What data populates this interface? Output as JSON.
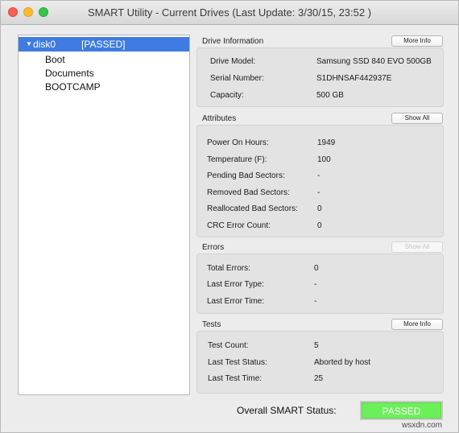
{
  "window": {
    "title": "SMART Utility - Current Drives (Last Update: 3/30/15, 23:52 )"
  },
  "sidebar": {
    "disk": {
      "name": "disk0",
      "status": "[PASSED]"
    },
    "volumes": [
      "Boot",
      "Documents",
      "BOOTCAMP"
    ]
  },
  "drive_information": {
    "title": "Drive Information",
    "button": "More Info",
    "rows": [
      {
        "label": "Drive Model:",
        "value": "Samsung SSD 840 EVO 500GB"
      },
      {
        "label": "Serial Number:",
        "value": "S1DHNSAF442937E"
      },
      {
        "label": "Capacity:",
        "value": "500 GB"
      }
    ]
  },
  "attributes": {
    "title": "Attributes",
    "button": "Show All",
    "rows": [
      {
        "label": "Power On Hours:",
        "value": "1949"
      },
      {
        "label": "Temperature (F):",
        "value": "100"
      },
      {
        "label": "Pending Bad Sectors:",
        "value": "-"
      },
      {
        "label": "Removed Bad Sectors:",
        "value": "-"
      },
      {
        "label": "Reallocated Bad Sectors:",
        "value": "0"
      },
      {
        "label": "CRC Error Count:",
        "value": "0"
      }
    ]
  },
  "errors": {
    "title": "Errors",
    "button": "Show All",
    "rows": [
      {
        "label": "Total Errors:",
        "value": "0"
      },
      {
        "label": "Last Error Type:",
        "value": "-"
      },
      {
        "label": "Last Error Time:",
        "value": "-"
      }
    ]
  },
  "tests": {
    "title": "Tests",
    "button": "More Info",
    "rows": [
      {
        "label": "Test Count:",
        "value": "5"
      },
      {
        "label": "Last Test Status:",
        "value": "Aborted by host"
      },
      {
        "label": "Last Test Time:",
        "value": "25"
      }
    ]
  },
  "overall": {
    "label": "Overall SMART Status:",
    "status": "PASSED",
    "status_color": "#6cf05a"
  },
  "watermark": "wsxdn.com",
  "colors": {
    "selection": "#3f7be0",
    "close": "#fc5f57",
    "minimize": "#fdbc2e",
    "zoom": "#33c748"
  }
}
